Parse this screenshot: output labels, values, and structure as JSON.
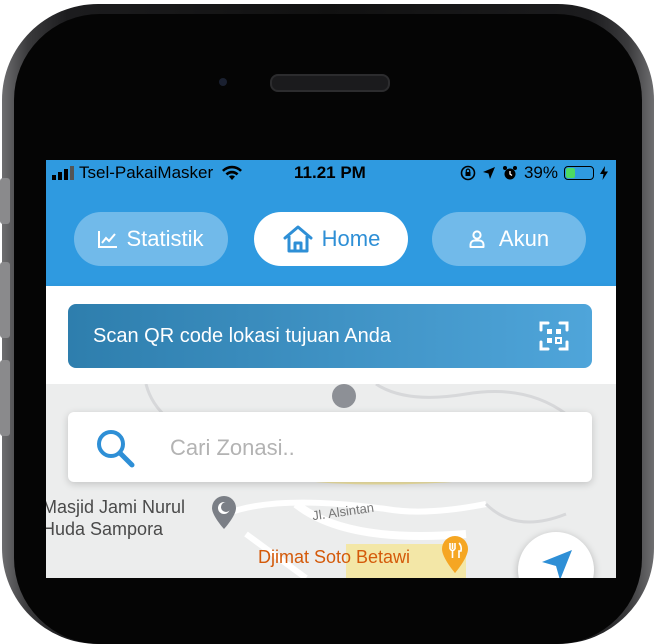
{
  "status_bar": {
    "carrier": "Tsel-PakaiMasker",
    "time": "11.21 PM",
    "battery": "39%",
    "battery_level": 0.39
  },
  "nav": {
    "statistik_label": "Statistik",
    "home_label": "Home",
    "akun_label": "Akun",
    "active": "home"
  },
  "scan": {
    "label": "Scan QR code lokasi tujuan Anda"
  },
  "search": {
    "placeholder": "Cari Zonasi.."
  },
  "map": {
    "poi_masjid": "Masjid Jami Nurul\nHuda Sampora",
    "poi_soto": "Djimat Soto Betawi",
    "road_alsintan": "Jl. Alsintan"
  },
  "colors": {
    "primary": "#2f9ae0",
    "active_text": "#2e8fd6",
    "scan_gradient_start": "#2e7ead",
    "scan_gradient_end": "#4fa5da",
    "battery_green": "#4cd964",
    "poi_orange": "#f5a623"
  },
  "icons": {
    "statistik": "chart-line-icon",
    "home": "home-icon",
    "akun": "user-icon",
    "scan": "qr-scan-icon",
    "search": "search-icon",
    "locate": "navigation-arrow-icon"
  }
}
